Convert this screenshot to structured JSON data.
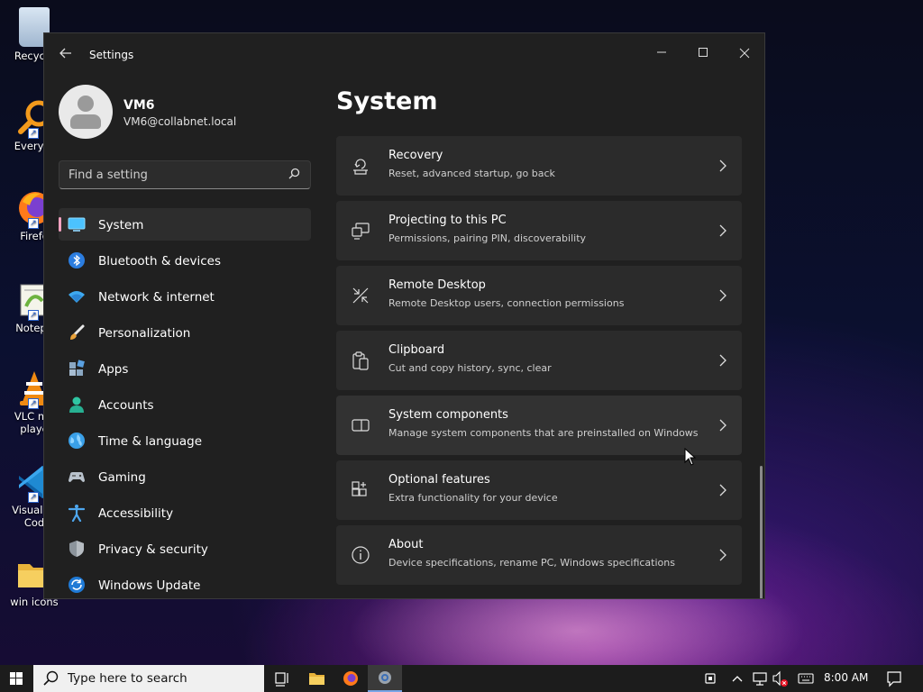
{
  "desktop": {
    "icons": [
      {
        "label": "Recycle"
      },
      {
        "label": "Everyth"
      },
      {
        "label": "Firefo"
      },
      {
        "label": "Notepa"
      },
      {
        "label": "VLC me\nplaye"
      },
      {
        "label": "Visual St\nCod"
      },
      {
        "label": "win icons"
      }
    ]
  },
  "window": {
    "title": "Settings",
    "user": {
      "name": "VM6",
      "email": "VM6@collabnet.local"
    },
    "search": {
      "placeholder": "Find a setting"
    },
    "nav": [
      {
        "label": "System",
        "icon": "system-icon",
        "selected": true
      },
      {
        "label": "Bluetooth & devices",
        "icon": "bluetooth-icon"
      },
      {
        "label": "Network & internet",
        "icon": "wifi-icon"
      },
      {
        "label": "Personalization",
        "icon": "brush-icon"
      },
      {
        "label": "Apps",
        "icon": "apps-icon"
      },
      {
        "label": "Accounts",
        "icon": "person-icon"
      },
      {
        "label": "Time & language",
        "icon": "globe-icon"
      },
      {
        "label": "Gaming",
        "icon": "gamepad-icon"
      },
      {
        "label": "Accessibility",
        "icon": "accessibility-icon"
      },
      {
        "label": "Privacy & security",
        "icon": "shield-icon"
      },
      {
        "label": "Windows Update",
        "icon": "update-icon"
      }
    ],
    "page_title": "System",
    "cards": [
      {
        "title": "Recovery",
        "subtitle": "Reset, advanced startup, go back",
        "icon": "recovery-icon"
      },
      {
        "title": "Projecting to this PC",
        "subtitle": "Permissions, pairing PIN, discoverability",
        "icon": "projector-icon"
      },
      {
        "title": "Remote Desktop",
        "subtitle": "Remote Desktop users, connection permissions",
        "icon": "remote-desktop-icon"
      },
      {
        "title": "Clipboard",
        "subtitle": "Cut and copy history, sync, clear",
        "icon": "clipboard-icon"
      },
      {
        "title": "System components",
        "subtitle": "Manage system components that are preinstalled on Windows",
        "icon": "components-icon"
      },
      {
        "title": "Optional features",
        "subtitle": "Extra functionality for your device",
        "icon": "optional-features-icon"
      },
      {
        "title": "About",
        "subtitle": "Device specifications, rename PC, Windows specifications",
        "icon": "info-icon"
      }
    ]
  },
  "taskbar": {
    "search_placeholder": "Type here to search",
    "time": "8:00 AM"
  },
  "colors": {
    "accent": "#f4a2c0",
    "window_bg": "#202020",
    "card_bg": "#2b2b2b"
  }
}
